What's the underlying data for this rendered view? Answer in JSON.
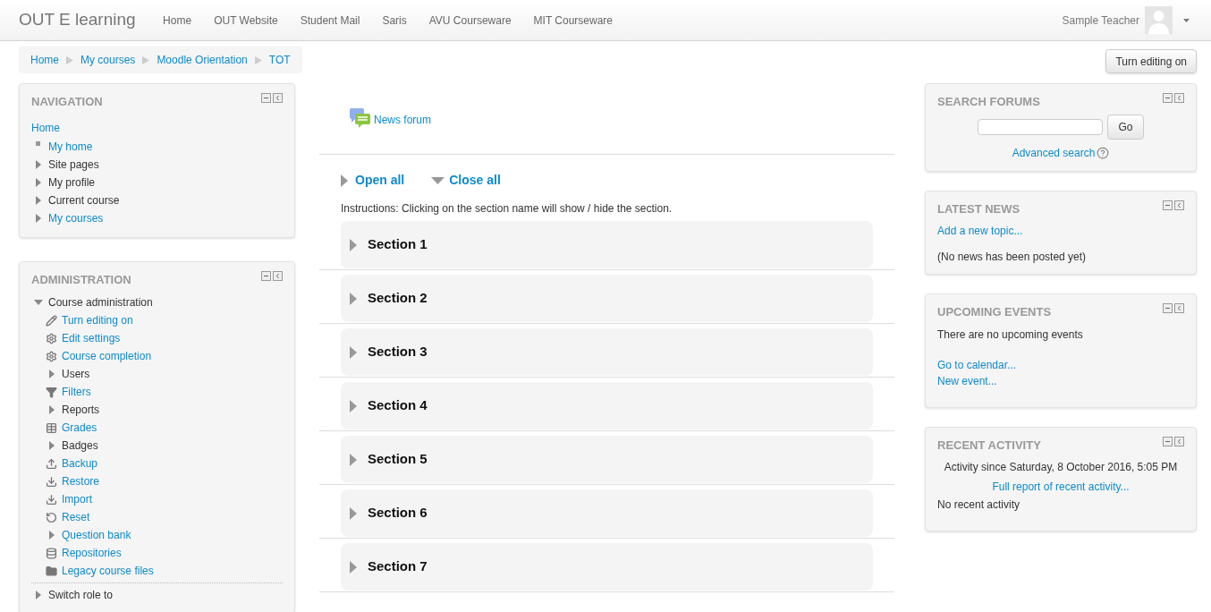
{
  "navbar": {
    "brand": "OUT E learning",
    "links": [
      "Home",
      "OUT Website",
      "Student Mail",
      "Saris",
      "AVU Courseware",
      "MIT Courseware"
    ],
    "user": "Sample Teacher"
  },
  "breadcrumb": [
    "Home",
    "My courses",
    "Moodle Orientation",
    "TOT"
  ],
  "edit_button": "Turn editing on",
  "navigation": {
    "title": "NAVIGATION",
    "home": "Home",
    "items": [
      {
        "label": "My home",
        "kind": "leaf",
        "link": true
      },
      {
        "label": "Site pages",
        "kind": "collapsed",
        "link": false
      },
      {
        "label": "My profile",
        "kind": "collapsed",
        "link": false
      },
      {
        "label": "Current course",
        "kind": "collapsed",
        "link": false
      },
      {
        "label": "My courses",
        "kind": "collapsed",
        "link": true
      }
    ]
  },
  "administration": {
    "title": "ADMINISTRATION",
    "items": [
      {
        "label": "Course administration",
        "kind": "expanded",
        "link": false,
        "children": [
          {
            "label": "Turn editing on",
            "kind": "pencil",
            "link": true
          },
          {
            "label": "Edit settings",
            "kind": "gear",
            "link": true
          },
          {
            "label": "Course completion",
            "kind": "gear",
            "link": true
          },
          {
            "label": "Users",
            "kind": "collapsed",
            "link": false
          },
          {
            "label": "Filters",
            "kind": "filter",
            "link": true
          },
          {
            "label": "Reports",
            "kind": "collapsed",
            "link": false
          },
          {
            "label": "Grades",
            "kind": "table",
            "link": true
          },
          {
            "label": "Badges",
            "kind": "collapsed",
            "link": false
          },
          {
            "label": "Backup",
            "kind": "upload",
            "link": true
          },
          {
            "label": "Restore",
            "kind": "download",
            "link": true
          },
          {
            "label": "Import",
            "kind": "download",
            "link": true
          },
          {
            "label": "Reset",
            "kind": "reset",
            "link": true
          },
          {
            "label": "Question bank",
            "kind": "collapsed",
            "link": true
          },
          {
            "label": "Repositories",
            "kind": "database",
            "link": true
          },
          {
            "label": "Legacy course files",
            "kind": "folder",
            "link": true
          }
        ]
      },
      {
        "label": "Switch role to",
        "kind": "collapsed",
        "link": false
      }
    ]
  },
  "course": {
    "forum": "News forum",
    "open_all": "Open all",
    "close_all": "Close all",
    "instructions": "Instructions: Clicking on the section name will show / hide the section.",
    "sections": [
      "Section 1",
      "Section 2",
      "Section 3",
      "Section 4",
      "Section 5",
      "Section 6",
      "Section 7"
    ]
  },
  "search_forums": {
    "title": "SEARCH FORUMS",
    "button": "Go",
    "advanced": "Advanced search"
  },
  "latest_news": {
    "title": "LATEST NEWS",
    "add": "Add a new topic...",
    "empty": "(No news has been posted yet)"
  },
  "upcoming_events": {
    "title": "UPCOMING EVENTS",
    "empty": "There are no upcoming events",
    "links": [
      "Go to calendar...",
      "New event..."
    ]
  },
  "recent_activity": {
    "title": "RECENT ACTIVITY",
    "since": "Activity since Saturday, 8 October 2016, 5:05 PM",
    "report": "Full report of recent activity...",
    "empty": "No recent activity"
  }
}
